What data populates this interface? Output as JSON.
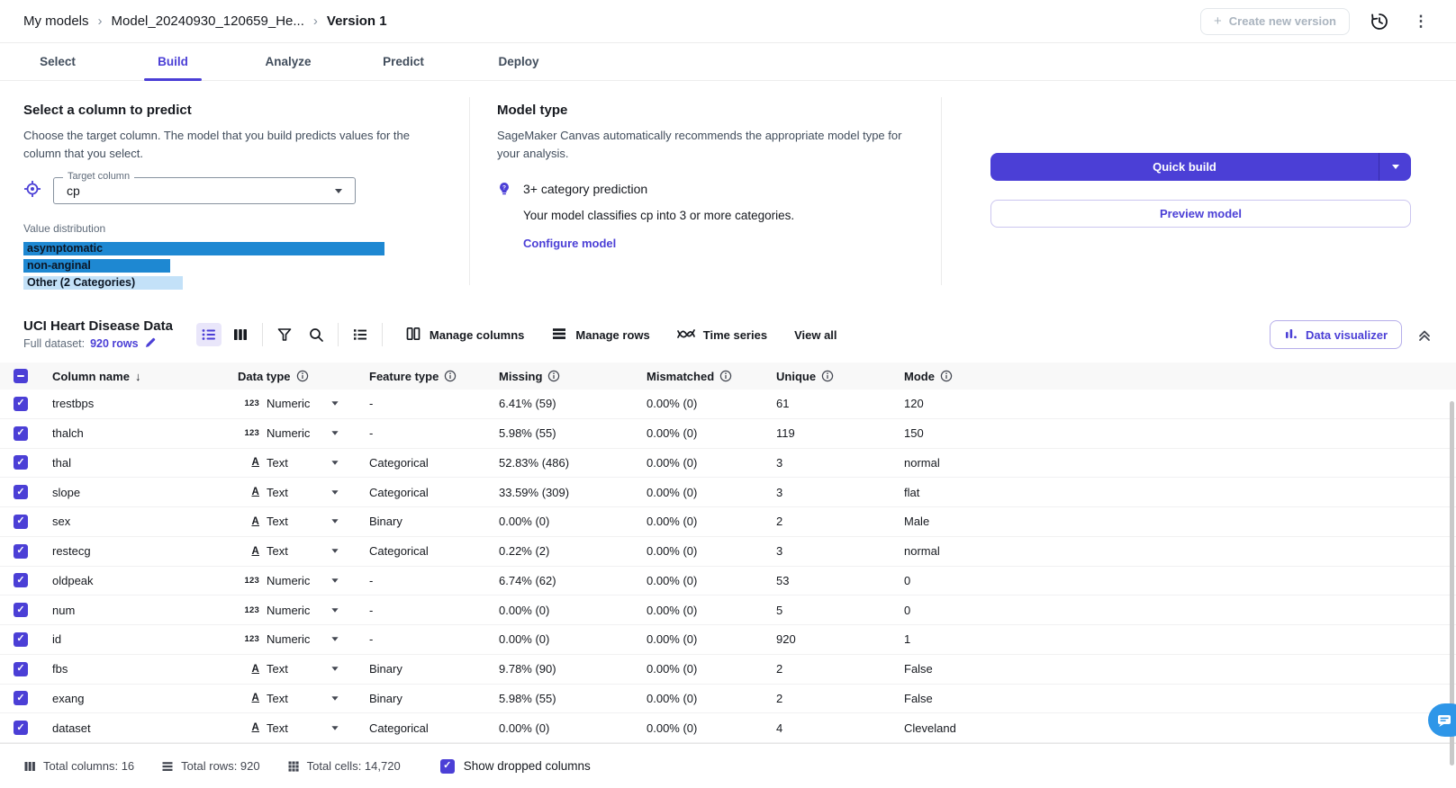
{
  "colors": {
    "accent": "#4b3fd6",
    "bar_blue": "#1e88d2",
    "bar_light_blue": "#c3e1f8",
    "chat_blue": "#2e96e8"
  },
  "breadcrumb": {
    "items": [
      "My models",
      "Model_20240930_120659_He...",
      "Version 1"
    ]
  },
  "header_actions": {
    "create_new_version": "Create new version"
  },
  "tabs": [
    {
      "label": "Select"
    },
    {
      "label": "Build"
    },
    {
      "label": "Analyze"
    },
    {
      "label": "Predict"
    },
    {
      "label": "Deploy"
    }
  ],
  "active_tab": "Build",
  "predict_panel": {
    "title": "Select a column to predict",
    "description": "Choose the target column. The model that you build predicts values for the column that you select.",
    "target_column": {
      "label": "Target column",
      "value": "cp"
    },
    "distribution": {
      "label": "Value distribution",
      "bars": [
        {
          "label": "asymptomatic",
          "width_pct": 86,
          "color": "#1e88d2"
        },
        {
          "label": "non-anginal",
          "width_pct": 35,
          "color": "#1e88d2"
        },
        {
          "label": "Other (2 Categories)",
          "width_pct": 38,
          "color": "#c3e1f8"
        }
      ]
    }
  },
  "model_type_panel": {
    "title": "Model type",
    "description": "SageMaker Canvas automatically recommends the appropriate model type for your analysis.",
    "recommendation": "3+ category prediction",
    "recommendation_detail": "Your model classifies cp into 3 or more categories.",
    "configure_link": "Configure model"
  },
  "build_actions": {
    "quick_build": "Quick build",
    "preview_model": "Preview model"
  },
  "dataset_toolbar": {
    "title": "UCI Heart Disease Data",
    "subtitle_prefix": "Full dataset:",
    "rows_link": "920 rows",
    "manage_columns": "Manage columns",
    "manage_rows": "Manage rows",
    "time_series": "Time series",
    "view_all": "View all",
    "data_visualizer": "Data visualizer"
  },
  "table": {
    "header": {
      "column_name": "Column name",
      "data_type": "Data type",
      "feature_type": "Feature type",
      "missing": "Missing",
      "mismatched": "Mismatched",
      "unique": "Unique",
      "mode": "Mode"
    },
    "rows": [
      {
        "name": "trestbps",
        "glyph": "123",
        "data_type": "Numeric",
        "feature_type": "-",
        "missing": "6.41% (59)",
        "mismatched": "0.00% (0)",
        "unique": "61",
        "mode": "120"
      },
      {
        "name": "thalch",
        "glyph": "123",
        "data_type": "Numeric",
        "feature_type": "-",
        "missing": "5.98% (55)",
        "mismatched": "0.00% (0)",
        "unique": "119",
        "mode": "150"
      },
      {
        "name": "thal",
        "glyph": "A",
        "data_type": "Text",
        "feature_type": "Categorical",
        "missing": "52.83% (486)",
        "mismatched": "0.00% (0)",
        "unique": "3",
        "mode": "normal"
      },
      {
        "name": "slope",
        "glyph": "A",
        "data_type": "Text",
        "feature_type": "Categorical",
        "missing": "33.59% (309)",
        "mismatched": "0.00% (0)",
        "unique": "3",
        "mode": "flat"
      },
      {
        "name": "sex",
        "glyph": "A",
        "data_type": "Text",
        "feature_type": "Binary",
        "missing": "0.00% (0)",
        "mismatched": "0.00% (0)",
        "unique": "2",
        "mode": "Male"
      },
      {
        "name": "restecg",
        "glyph": "A",
        "data_type": "Text",
        "feature_type": "Categorical",
        "missing": "0.22% (2)",
        "mismatched": "0.00% (0)",
        "unique": "3",
        "mode": "normal"
      },
      {
        "name": "oldpeak",
        "glyph": "123",
        "data_type": "Numeric",
        "feature_type": "-",
        "missing": "6.74% (62)",
        "mismatched": "0.00% (0)",
        "unique": "53",
        "mode": "0"
      },
      {
        "name": "num",
        "glyph": "123",
        "data_type": "Numeric",
        "feature_type": "-",
        "missing": "0.00% (0)",
        "mismatched": "0.00% (0)",
        "unique": "5",
        "mode": "0"
      },
      {
        "name": "id",
        "glyph": "123",
        "data_type": "Numeric",
        "feature_type": "-",
        "missing": "0.00% (0)",
        "mismatched": "0.00% (0)",
        "unique": "920",
        "mode": "1"
      },
      {
        "name": "fbs",
        "glyph": "A",
        "data_type": "Text",
        "feature_type": "Binary",
        "missing": "9.78% (90)",
        "mismatched": "0.00% (0)",
        "unique": "2",
        "mode": "False"
      },
      {
        "name": "exang",
        "glyph": "A",
        "data_type": "Text",
        "feature_type": "Binary",
        "missing": "5.98% (55)",
        "mismatched": "0.00% (0)",
        "unique": "2",
        "mode": "False"
      },
      {
        "name": "dataset",
        "glyph": "A",
        "data_type": "Text",
        "feature_type": "Categorical",
        "missing": "0.00% (0)",
        "mismatched": "0.00% (0)",
        "unique": "4",
        "mode": "Cleveland"
      }
    ]
  },
  "footer": {
    "total_columns": "Total columns: 16",
    "total_rows": "Total rows: 920",
    "total_cells": "Total cells: 14,720",
    "show_dropped": "Show dropped columns"
  }
}
